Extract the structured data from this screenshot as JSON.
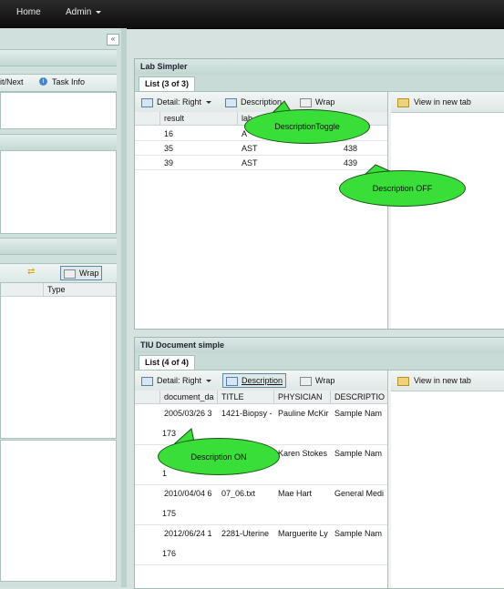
{
  "nav": {
    "home": "Home",
    "admin": "Admin"
  },
  "left": {
    "collapse_symbol": "«",
    "tab_next": "it/Next",
    "tab_taskinfo": "Task Info",
    "wrap_label": "Wrap",
    "type_header": "Type"
  },
  "lab": {
    "title": "Lab Simpler",
    "tab": "List (3 of 3)",
    "toolbar": {
      "detail": "Detail: Right",
      "description": "Description",
      "wrap": "Wrap"
    },
    "columns": [
      "result",
      "lab"
    ],
    "rows": [
      {
        "result": "16",
        "lab": "A",
        "num": ""
      },
      {
        "result": "35",
        "lab": "AST",
        "num": "438"
      },
      {
        "result": "39",
        "lab": "AST",
        "num": "439"
      }
    ],
    "view_in_new_tab": "View in new tab"
  },
  "tiu": {
    "title": "TIU Document simple",
    "tab": "List (4 of 4)",
    "toolbar": {
      "detail": "Detail: Right",
      "description": "Description",
      "wrap": "Wrap"
    },
    "columns": [
      "document_da",
      "TITLE",
      "PHYSICIAN",
      "DESCRIPTIO"
    ],
    "rows": [
      {
        "date": "2005/03/26 3",
        "title": "1421-Biopsy -",
        "physician": "Pauline McKir",
        "desc": "Sample Nam",
        "num": "173"
      },
      {
        "date": "",
        "title": "",
        "physician": "Karen Stokes",
        "desc": "Sample Nam",
        "num": "1"
      },
      {
        "date": "2010/04/04 6",
        "title": "07_06.txt",
        "physician": "Mae Hart",
        "desc": "General Medi",
        "num": "175"
      },
      {
        "date": "2012/06/24 1",
        "title": "2281-Uterine",
        "physician": "Marguerite Ly",
        "desc": "Sample Nam",
        "num": "176"
      }
    ],
    "view_in_new_tab": "View in new tab"
  },
  "callouts": {
    "toggle": "DescriptionToggle",
    "off": "Description OFF",
    "on": "Description ON"
  },
  "colors": {
    "callout_green": "#3ade38",
    "active_border": "#5d86a2"
  }
}
